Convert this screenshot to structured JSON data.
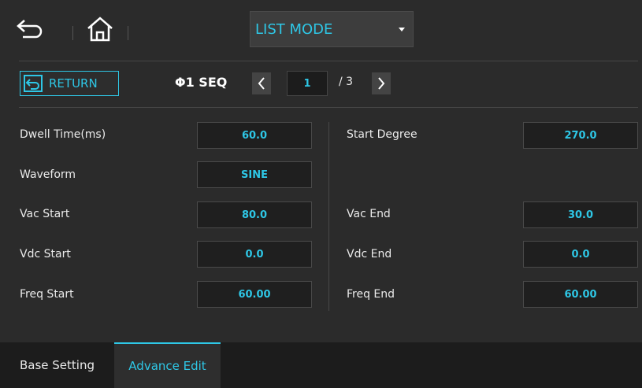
{
  "header": {
    "mode_select": {
      "value": "LIST MODE"
    }
  },
  "toolbar": {
    "return_label": "RETURN",
    "seq_label": "Φ1 SEQ",
    "page_current": "1",
    "page_total": "/ 3"
  },
  "params": {
    "dwell_time": {
      "label": "Dwell Time(ms)",
      "value": "60.0"
    },
    "waveform": {
      "label": "Waveform",
      "value": "SINE"
    },
    "vac_start": {
      "label": "Vac Start",
      "value": "80.0"
    },
    "vdc_start": {
      "label": "Vdc Start",
      "value": "0.0"
    },
    "freq_start": {
      "label": "Freq Start",
      "value": "60.00"
    },
    "start_degree": {
      "label": "Start Degree",
      "value": "270.0"
    },
    "vac_end": {
      "label": "Vac End",
      "value": "30.0"
    },
    "vdc_end": {
      "label": "Vdc End",
      "value": "0.0"
    },
    "freq_end": {
      "label": "Freq End",
      "value": "60.00"
    }
  },
  "tabs": [
    {
      "label": "Base Setting",
      "active": false
    },
    {
      "label": "Advance Edit",
      "active": true
    }
  ],
  "colors": {
    "accent": "#2ec7e6",
    "background": "#2b2b2b",
    "field": "#1f1f1f"
  },
  "icons": [
    "back-icon",
    "home-icon",
    "dropdown-caret-icon",
    "return-icon",
    "chevron-left-icon",
    "chevron-right-icon"
  ]
}
